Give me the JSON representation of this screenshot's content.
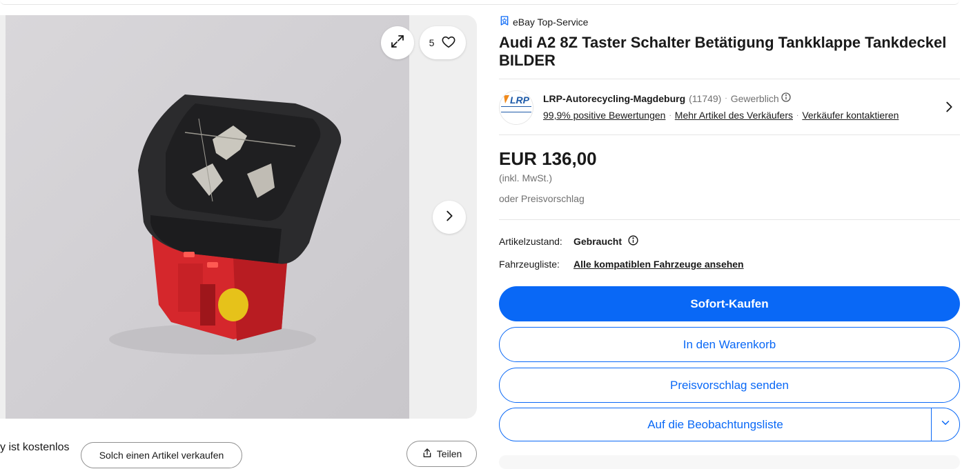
{
  "gallery": {
    "watch_count": "5",
    "icons": {
      "expand": "expand-icon",
      "heart": "heart-icon",
      "next": "chevron-right-icon"
    }
  },
  "below_gallery": {
    "free_text": "y ist kostenlos",
    "sell_button": "Solch einen Artikel verkaufen",
    "share_button": "Teilen"
  },
  "listing": {
    "badge": "eBay Top-Service",
    "title": "Audi A2 8Z Taster Schalter Betätigung Tankklappe Tankdeckel BILDER"
  },
  "seller": {
    "logo_text": "LRP",
    "name": "LRP-Autorecycling-Magdeburg",
    "feedback_count": "(11749)",
    "type": "Gewerblich",
    "positive": "99,9% positive Bewertungen",
    "more_items": "Mehr Artikel des Verkäufers",
    "contact": "Verkäufer kontaktieren"
  },
  "price": {
    "amount": "EUR 136,00",
    "vat": "(inkl. MwSt.)",
    "offer": "oder Preisvorschlag"
  },
  "attributes": {
    "condition_label": "Artikelzustand:",
    "condition_value": "Gebraucht",
    "vehicles_label": "Fahrzeugliste:",
    "vehicles_link": "Alle kompatiblen Fahrzeuge ansehen"
  },
  "actions": {
    "buy_now": "Sofort-Kaufen",
    "add_to_cart": "In den Warenkorb",
    "make_offer": "Preisvorschlag senden",
    "watchlist": "Auf die Beobachtungsliste"
  },
  "colors": {
    "primary": "#0968f6",
    "text": "#191919",
    "muted": "#707070"
  }
}
